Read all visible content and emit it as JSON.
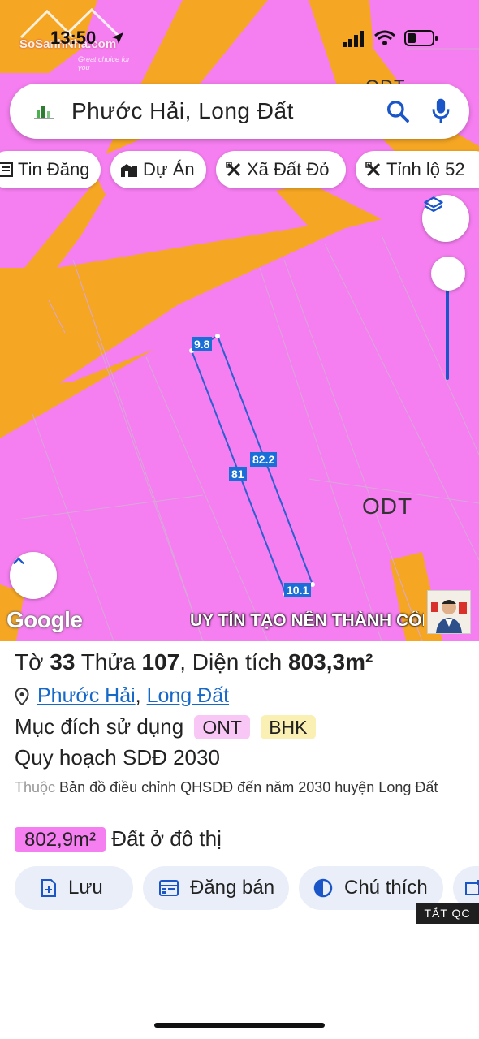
{
  "status_bar": {
    "time": "13:50",
    "watermark_brand": "SoSanhNha.com",
    "watermark_tagline": "Great choice for you"
  },
  "search": {
    "query": "Phước Hải, Long Đất"
  },
  "filters": [
    {
      "label": "Tin Đăng",
      "icon": "news-icon"
    },
    {
      "label": "Dự Án",
      "icon": "building-icon"
    },
    {
      "label": "Xã Đất Đỏ",
      "icon": "close-x-icon"
    },
    {
      "label": "Tỉnh lộ 52",
      "icon": "close-x-icon"
    }
  ],
  "map": {
    "zone_label": "ODT",
    "top_zone_label": "ODT",
    "dimensions": {
      "top": "9.8",
      "left": "81",
      "right": "82.2",
      "bottom": "10.1"
    },
    "attribution": "Google",
    "ticker_text": "UY TÍN TẠO NÊN THÀNH CÔNG"
  },
  "parcel": {
    "sheet_label": "Tờ",
    "sheet_no": "33",
    "plot_label": "Thửa",
    "plot_no": "107",
    "area_label": "Diện tích",
    "area": "803,3m²",
    "ward": "Phước Hải",
    "district": "Long Đất",
    "land_use_label": "Mục đích sử dụng",
    "land_use_codes": [
      "ONT",
      "BHK"
    ],
    "plan_title": "Quy hoạch SDĐ 2030",
    "belongs_prefix": "Thuộc",
    "belongs_text": "Bản đồ điều chỉnh QHSDĐ đến năm 2030 huyện Long Đất",
    "zoned_area": "802,9m²",
    "zoned_type": "Đất ở đô thị"
  },
  "actions": [
    {
      "label": "Lưu",
      "icon": "save-icon"
    },
    {
      "label": "Đăng bán",
      "icon": "post-icon"
    },
    {
      "label": "Chú thích",
      "icon": "legend-icon"
    }
  ],
  "ad_close": "TẮT QC",
  "colors": {
    "zone_pink": "#f57ef0",
    "road_orange": "#f5a623",
    "accent_blue": "#1a6fd6",
    "ont_tag": "#f9c7f5",
    "bhk_tag": "#fbf0b4"
  }
}
